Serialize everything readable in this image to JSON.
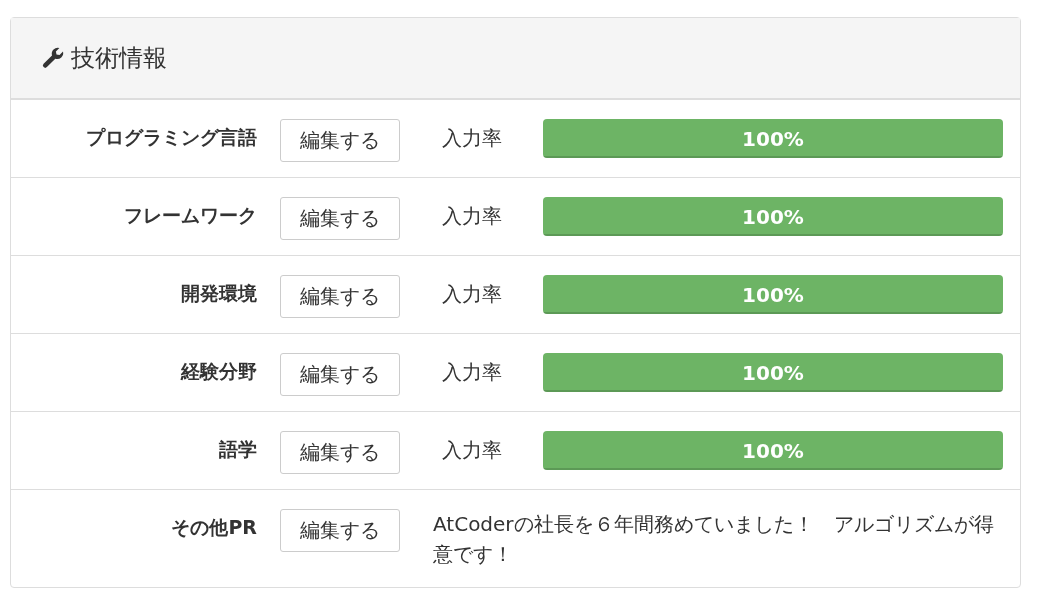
{
  "panel": {
    "title": "技術情報"
  },
  "rows": [
    {
      "label": "プログラミング言語",
      "button": "編集する",
      "kind": "progress",
      "caption": "入力率",
      "level": 1,
      "reading": "100%"
    },
    {
      "label": "フレームワーク",
      "button": "編集する",
      "kind": "progress",
      "caption": "入力率",
      "level": 1,
      "reading": "100%"
    },
    {
      "label": "開発環境",
      "button": "編集する",
      "kind": "progress",
      "caption": "入力率",
      "level": 1,
      "reading": "100%"
    },
    {
      "label": "経験分野",
      "button": "編集する",
      "kind": "progress",
      "caption": "入力率",
      "level": 1,
      "reading": "100%"
    },
    {
      "label": "語学",
      "button": "編集する",
      "kind": "progress",
      "caption": "入力率",
      "level": 1,
      "reading": "100%"
    },
    {
      "label": "その他PR",
      "button": "編集する",
      "kind": "text",
      "text": "AtCoderの社長を６年間務めていました！　アルゴリズムが得意です！"
    }
  ]
}
